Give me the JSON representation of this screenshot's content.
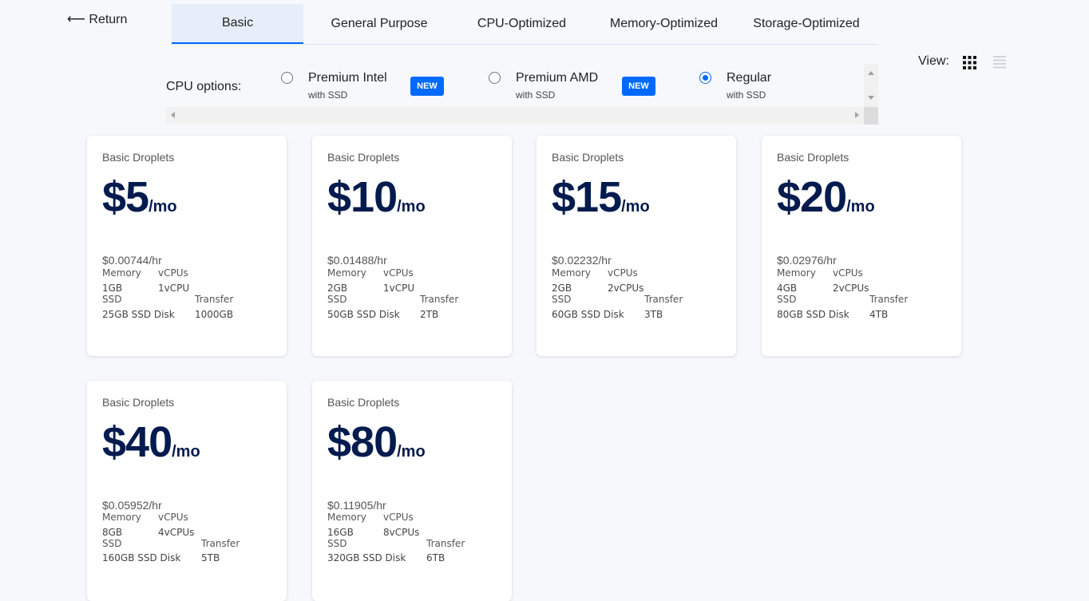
{
  "nav": {
    "return_label": "⟵ Return"
  },
  "tabs": [
    {
      "label": "Basic",
      "active": true
    },
    {
      "label": "General Purpose",
      "active": false
    },
    {
      "label": "CPU-Optimized",
      "active": false
    },
    {
      "label": "Memory-Optimized",
      "active": false
    },
    {
      "label": "Storage-Optimized",
      "active": false
    }
  ],
  "cpu_options": {
    "label": "CPU options:",
    "options": [
      {
        "name": "Premium Intel",
        "sub": "with SSD",
        "badge": "NEW",
        "selected": false
      },
      {
        "name": "Premium AMD",
        "sub": "with SSD",
        "badge": "NEW",
        "selected": false
      },
      {
        "name": "Regular",
        "sub": "with SSD",
        "badge": "",
        "selected": true
      }
    ]
  },
  "view": {
    "label": "View:",
    "mode": "grid"
  },
  "labels": {
    "memory": "Memory",
    "vcpus": "vCPUs",
    "ssd": "SSD",
    "transfer": "Transfer"
  },
  "plans": [
    {
      "title": "Basic Droplets",
      "price": "$5",
      "per": "/mo",
      "hourly": "$0.00744/hr",
      "memory": "1GB",
      "vcpus": "1vCPU",
      "ssd": "25GB SSD Disk",
      "transfer": "1000GB"
    },
    {
      "title": "Basic Droplets",
      "price": "$10",
      "per": "/mo",
      "hourly": "$0.01488/hr",
      "memory": "2GB",
      "vcpus": "1vCPU",
      "ssd": "50GB SSD Disk",
      "transfer": "2TB"
    },
    {
      "title": "Basic Droplets",
      "price": "$15",
      "per": "/mo",
      "hourly": "$0.02232/hr",
      "memory": "2GB",
      "vcpus": "2vCPUs",
      "ssd": "60GB SSD Disk",
      "transfer": "3TB"
    },
    {
      "title": "Basic Droplets",
      "price": "$20",
      "per": "/mo",
      "hourly": "$0.02976/hr",
      "memory": "4GB",
      "vcpus": "2vCPUs",
      "ssd": "80GB SSD Disk",
      "transfer": "4TB"
    },
    {
      "title": "Basic Droplets",
      "price": "$40",
      "per": "/mo",
      "hourly": "$0.05952/hr",
      "memory": "8GB",
      "vcpus": "4vCPUs",
      "ssd": "160GB SSD Disk",
      "transfer": "5TB"
    },
    {
      "title": "Basic Droplets",
      "price": "$80",
      "per": "/mo",
      "hourly": "$0.11905/hr",
      "memory": "16GB",
      "vcpus": "8vCPUs",
      "ssd": "320GB SSD Disk",
      "transfer": "6TB"
    }
  ],
  "colors": {
    "accent": "#0069ff",
    "price_text": "#031b4e",
    "background": "#f6f8fc",
    "active_tab_bg": "#e6eefb"
  }
}
